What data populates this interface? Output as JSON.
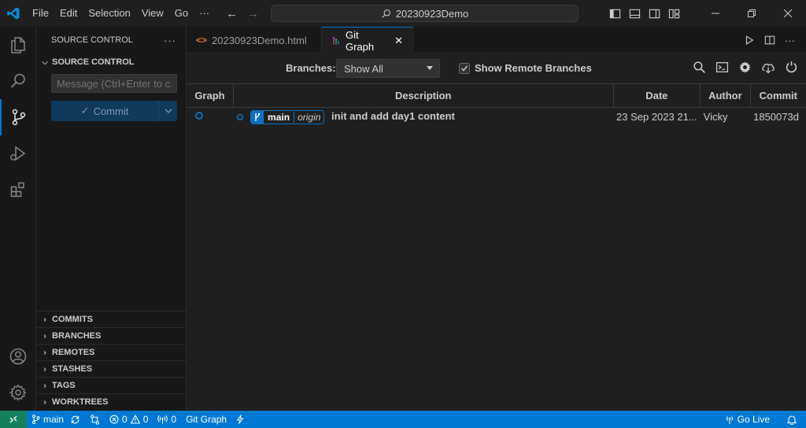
{
  "titlebar": {
    "menu": [
      "File",
      "Edit",
      "Selection",
      "View",
      "Go"
    ],
    "more": "···",
    "command_center": "20230923Demo"
  },
  "sidebar": {
    "title": "SOURCE CONTROL",
    "more": "···",
    "section": "SOURCE CONTROL",
    "message_placeholder": "Message (Ctrl+Enter to c...",
    "commit_label": "Commit",
    "sections": [
      "COMMITS",
      "BRANCHES",
      "REMOTES",
      "STASHES",
      "TAGS",
      "WORKTREES"
    ]
  },
  "tabs": [
    {
      "label": "20230923Demo.html",
      "active": false
    },
    {
      "label": "Git Graph",
      "active": true,
      "close": "✕"
    }
  ],
  "gitgraph": {
    "branches_label": "Branches:",
    "branches_value": "Show All",
    "show_remote_label": "Show Remote Branches",
    "show_remote_checked": true,
    "columns": [
      "Graph",
      "Description",
      "Date",
      "Author",
      "Commit"
    ],
    "rows": [
      {
        "ref": "main",
        "remote": "origin",
        "message": "init and add day1 content",
        "date": "23 Sep 2023 21...",
        "author": "Vicky",
        "commit": "1850073d"
      }
    ]
  },
  "statusbar": {
    "branch": "main",
    "errors": "0",
    "warnings": "0",
    "ports": "0",
    "gitgraph": "Git Graph",
    "golive": "Go Live"
  },
  "colors": {
    "accent": "#0078d4",
    "remote_indicator": "#16825d",
    "graph_node": "#0e70c0"
  }
}
